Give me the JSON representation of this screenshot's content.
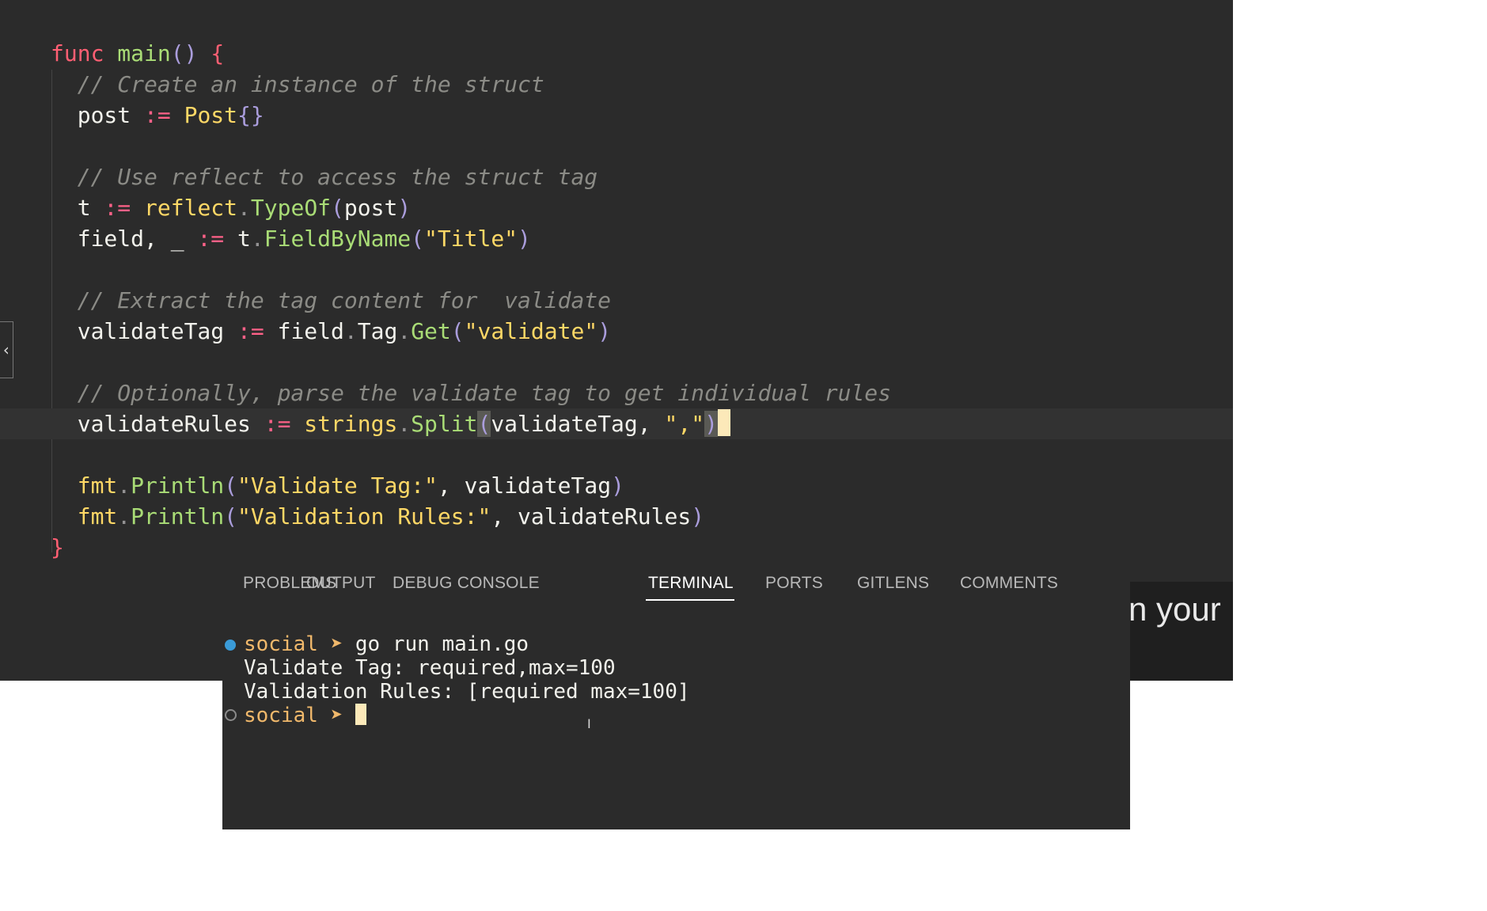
{
  "editor": {
    "lines": [
      {
        "id": "l1",
        "tokens": [
          [
            "kw",
            "func "
          ],
          [
            "fn",
            "main"
          ],
          [
            "br",
            "()"
          ],
          [
            "var",
            " "
          ],
          [
            "kw",
            "{"
          ]
        ]
      },
      {
        "id": "l2",
        "tokens": [
          [
            "cm",
            "  // Create an instance of the struct"
          ]
        ]
      },
      {
        "id": "l3",
        "tokens": [
          [
            "var",
            "  post "
          ],
          [
            "op",
            ":="
          ],
          [
            "var",
            " "
          ],
          [
            "ty",
            "Post"
          ],
          [
            "br",
            "{}"
          ]
        ]
      },
      {
        "id": "l4",
        "tokens": []
      },
      {
        "id": "l5",
        "tokens": [
          [
            "cm",
            "  // Use reflect to access the struct tag"
          ]
        ]
      },
      {
        "id": "l6",
        "tokens": [
          [
            "var",
            "  t "
          ],
          [
            "op",
            ":="
          ],
          [
            "var",
            " "
          ],
          [
            "pkg",
            "reflect"
          ],
          [
            "dot",
            "."
          ],
          [
            "fn",
            "TypeOf"
          ],
          [
            "br",
            "("
          ],
          [
            "var",
            "post"
          ],
          [
            "br",
            ")"
          ]
        ]
      },
      {
        "id": "l7",
        "tokens": [
          [
            "var",
            "  field, _ "
          ],
          [
            "op",
            ":="
          ],
          [
            "var",
            " t"
          ],
          [
            "dot",
            "."
          ],
          [
            "fn",
            "FieldByName"
          ],
          [
            "br",
            "("
          ],
          [
            "str",
            "\"Title\""
          ],
          [
            "br",
            ")"
          ]
        ]
      },
      {
        "id": "l8",
        "tokens": []
      },
      {
        "id": "l9",
        "tokens": [
          [
            "cm",
            "  // Extract the tag content for  validate"
          ]
        ]
      },
      {
        "id": "l10",
        "tokens": [
          [
            "var",
            "  validateTag "
          ],
          [
            "op",
            ":="
          ],
          [
            "var",
            " field"
          ],
          [
            "dot",
            "."
          ],
          [
            "var",
            "Tag"
          ],
          [
            "dot",
            "."
          ],
          [
            "fn",
            "Get"
          ],
          [
            "br",
            "("
          ],
          [
            "str",
            "\"validate\""
          ],
          [
            "br",
            ")"
          ]
        ]
      },
      {
        "id": "l11",
        "tokens": []
      },
      {
        "id": "l12",
        "tokens": [
          [
            "cm",
            "  // Optionally, parse the validate tag to get individual rules"
          ]
        ]
      },
      {
        "id": "l13",
        "tokens": [
          [
            "var",
            "  validateRules "
          ],
          [
            "op",
            ":="
          ],
          [
            "var",
            " "
          ],
          [
            "pkg",
            "strings"
          ],
          [
            "dot",
            "."
          ],
          [
            "fn",
            "Split"
          ],
          [
            "paren",
            "("
          ],
          [
            "var",
            "validateTag, "
          ],
          [
            "str",
            "\",\""
          ],
          [
            "paren",
            ")"
          ]
        ]
      },
      {
        "id": "l14",
        "tokens": []
      },
      {
        "id": "l15",
        "tokens": [
          [
            "var",
            "  "
          ],
          [
            "pkg",
            "fmt"
          ],
          [
            "dot",
            "."
          ],
          [
            "fn",
            "Println"
          ],
          [
            "br",
            "("
          ],
          [
            "str",
            "\"Validate Tag:\""
          ],
          [
            "var",
            ", validateTag"
          ],
          [
            "br",
            ")"
          ]
        ]
      },
      {
        "id": "l16",
        "tokens": [
          [
            "var",
            "  "
          ],
          [
            "pkg",
            "fmt"
          ],
          [
            "dot",
            "."
          ],
          [
            "fn",
            "Println"
          ],
          [
            "br",
            "("
          ],
          [
            "str",
            "\"Validation Rules:\""
          ],
          [
            "var",
            ", validateRules"
          ],
          [
            "br",
            ")"
          ]
        ]
      },
      {
        "id": "l17",
        "tokens": [
          [
            "kw",
            "}"
          ]
        ]
      }
    ]
  },
  "panel": {
    "tabs": [
      {
        "label": "PROBLEMS",
        "active": false
      },
      {
        "label": "OUTPUT",
        "active": false
      },
      {
        "label": "DEBUG CONSOLE",
        "active": false
      },
      {
        "label": "TERMINAL",
        "active": true
      },
      {
        "label": "PORTS",
        "active": false
      },
      {
        "label": "GITLENS",
        "active": false
      },
      {
        "label": "COMMENTS",
        "active": false
      }
    ],
    "terminal": {
      "prompt_dir": "social",
      "prompt_arrow": "➤",
      "command": "go run main.go",
      "output": [
        "Validate Tag: required,max=100",
        "Validation Rules: [required max=100]"
      ]
    }
  },
  "overlay": {
    "caption": "n your"
  },
  "colors": {
    "editor_bg": "#2b2b2b",
    "keyword": "#ff5f73",
    "function": "#a9dc76",
    "string": "#ffd866",
    "comment": "#8b8b86",
    "terminal_prompt": "#f0b86b",
    "status_dot": "#3a9bd8"
  }
}
